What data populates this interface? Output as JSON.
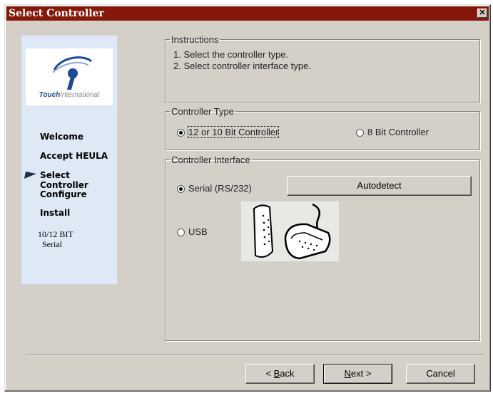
{
  "window": {
    "title": "Select Controller",
    "close_glyph": "✕",
    "title_color": "#85180b"
  },
  "sidebar": {
    "logo": {
      "brand_bold": "Touch",
      "brand_rest": "International",
      "icon": "touch-international-logo"
    },
    "steps": [
      {
        "label": "Welcome",
        "current": false
      },
      {
        "label": "Accept HEULA",
        "current": false
      },
      {
        "label": "Select Controller",
        "current": true
      },
      {
        "label": "Configure",
        "current": false
      },
      {
        "label": "Install",
        "current": false
      }
    ],
    "notes": [
      "10/12 BIT",
      "Serial"
    ]
  },
  "instructions": {
    "legend": "Instructions",
    "lines": [
      "1. Select the controller type.",
      "2. Select controller interface type."
    ]
  },
  "controller_type": {
    "legend": "Controller Type",
    "options": [
      {
        "label": "12 or 10 Bit Controller",
        "selected": true
      },
      {
        "label": "8 Bit Controller",
        "selected": false
      }
    ]
  },
  "controller_interface": {
    "legend": "Controller Interface",
    "options": [
      {
        "label": "Serial (RS/232)",
        "selected": true
      },
      {
        "label": "USB",
        "selected": false
      }
    ],
    "autodetect_label": "Autodetect",
    "image_icon": "serial-connector-image"
  },
  "footer": {
    "back": {
      "prefix": "< ",
      "mnemonic": "B",
      "rest": "ack"
    },
    "next": {
      "mnemonic": "N",
      "rest": "ext >"
    },
    "cancel": "Cancel"
  }
}
